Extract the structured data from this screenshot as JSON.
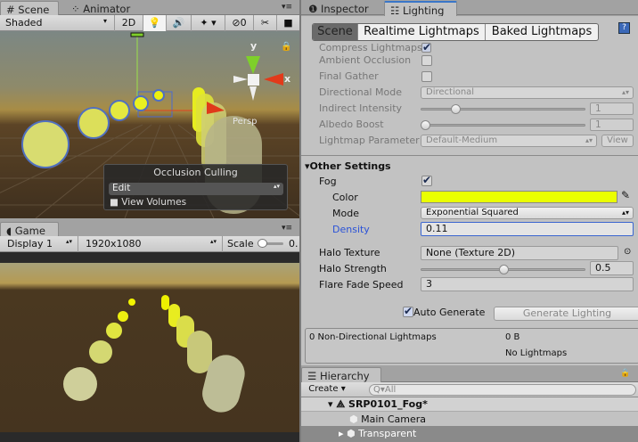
{
  "scene": {
    "tabs": [
      {
        "label": "Scene",
        "icon": "grid-icon"
      },
      {
        "label": "Animator",
        "icon": "animator-icon"
      }
    ],
    "toolbar": {
      "shading": "Shaded",
      "mode_2d": "2D",
      "hidden_count": "0"
    },
    "gizmo": {
      "y": "y",
      "x": "x",
      "projection": "Persp"
    },
    "occlusion": {
      "title": "Occlusion Culling",
      "mode": "Edit",
      "view_volumes": "View Volumes"
    }
  },
  "game": {
    "tab": "Game",
    "display": "Display 1",
    "resolution": "1920x1080",
    "scale_label": "Scale",
    "scale_value": "0."
  },
  "inspector": {
    "tabs": [
      "Inspector",
      "Lighting"
    ],
    "subtabs": [
      "Scene",
      "Realtime Lightmaps",
      "Baked Lightmaps"
    ],
    "cutoff_label": "Compress Lightmaps",
    "baked": [
      {
        "label": "Ambient Occlusion",
        "type": "checkbox",
        "checked": false
      },
      {
        "label": "Final Gather",
        "type": "checkbox",
        "checked": false
      },
      {
        "label": "Directional Mode",
        "type": "popup",
        "value": "Directional"
      },
      {
        "label": "Indirect Intensity",
        "type": "slider",
        "value": "1",
        "fraction": 0.2
      },
      {
        "label": "Albedo Boost",
        "type": "slider",
        "value": "1",
        "fraction": 0.0
      },
      {
        "label": "Lightmap Parameter",
        "type": "popup",
        "value": "Default-Medium",
        "button": "View"
      }
    ],
    "other": {
      "title": "Other Settings",
      "fog_label": "Fog",
      "fog_on": true,
      "color_label": "Color",
      "color": "#eaff00",
      "mode_label": "Mode",
      "mode": "Exponential Squared",
      "density_label": "Density",
      "density": "0.11",
      "halo_texture_label": "Halo Texture",
      "halo_texture": "None (Texture 2D)",
      "halo_strength_label": "Halo Strength",
      "halo_strength": "0.5",
      "halo_fraction": 0.5,
      "flare_label": "Flare Fade Speed",
      "flare": "3"
    },
    "auto_generate": "Auto Generate",
    "auto_on": true,
    "generate": "Generate Lighting",
    "stats": {
      "count": "0 Non-Directional Lightmaps",
      "size": "0 B",
      "status": "No Lightmaps"
    }
  },
  "hierarchy": {
    "tab": "Hierarchy",
    "create": "Create",
    "search_placeholder": "All",
    "scene": "SRP0101_Fog*",
    "items": [
      "Main Camera",
      "Transparent"
    ]
  }
}
